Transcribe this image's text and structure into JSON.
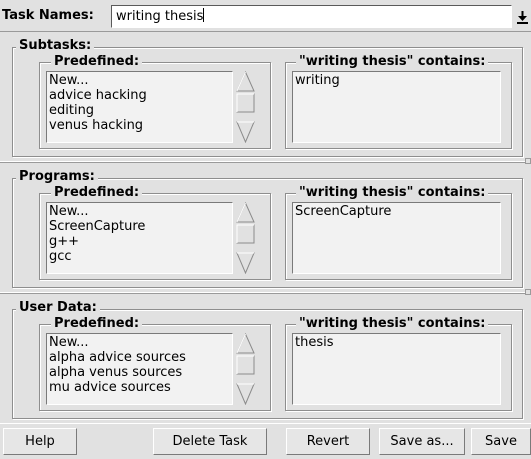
{
  "task": {
    "label": "Task Names:",
    "value": "writing thesis"
  },
  "sections": [
    {
      "title": "Subtasks:",
      "predefined_label": "Predefined:",
      "contains_label": "\"writing thesis\" contains:",
      "predefined_items": [
        "New...",
        "advice hacking",
        "editing",
        "venus hacking"
      ],
      "contains_items": [
        "writing"
      ]
    },
    {
      "title": "Programs:",
      "predefined_label": "Predefined:",
      "contains_label": "\"writing thesis\" contains:",
      "predefined_items": [
        "New...",
        "ScreenCapture",
        "g++",
        "gcc"
      ],
      "contains_items": [
        "ScreenCapture"
      ]
    },
    {
      "title": "User Data:",
      "predefined_label": "Predefined:",
      "contains_label": "\"writing thesis\" contains:",
      "predefined_items": [
        "New...",
        "alpha advice sources",
        "alpha venus sources",
        "mu advice sources"
      ],
      "contains_items": [
        "thesis"
      ]
    }
  ],
  "buttons": {
    "help": "Help",
    "delete": "Delete Task",
    "revert": "Revert",
    "save_as": "Save as...",
    "save": "Save"
  }
}
